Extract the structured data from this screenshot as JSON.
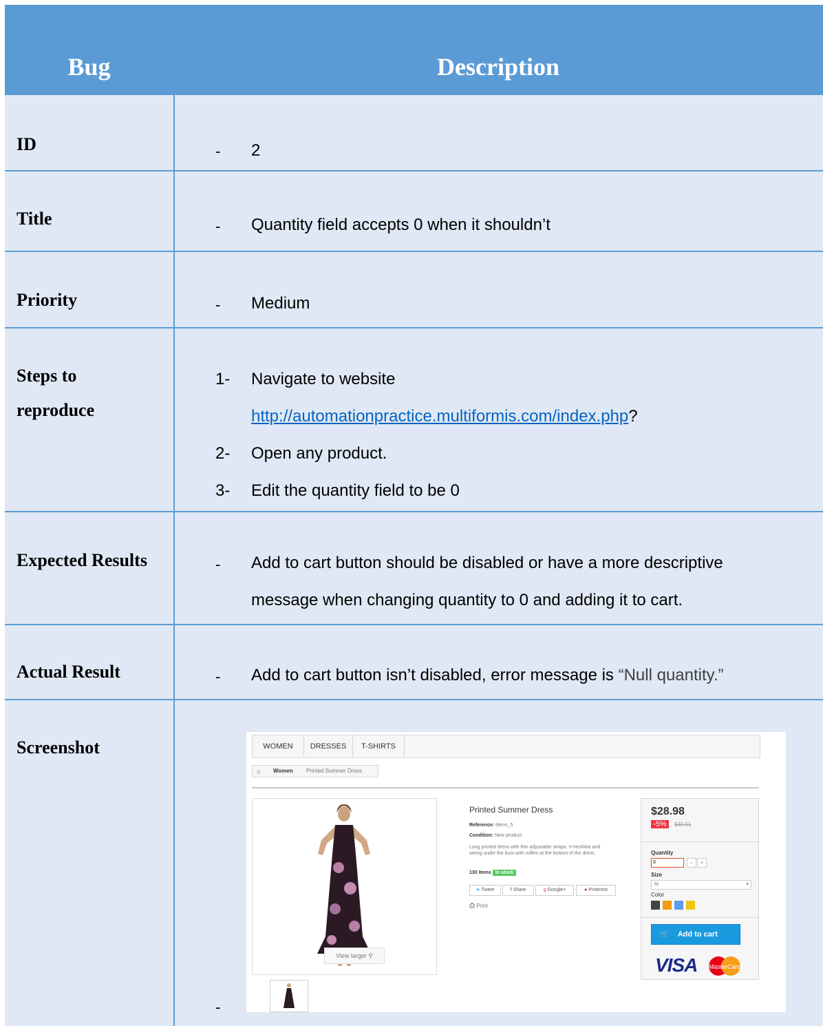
{
  "header": {
    "bug_label": "Bug",
    "description_label": "Description"
  },
  "rows": {
    "id": {
      "label": "ID",
      "dash": "-",
      "value": "2"
    },
    "title": {
      "label": "Title",
      "dash": "-",
      "value": "Quantity field accepts 0 when it shouldn’t"
    },
    "priority": {
      "label": "Priority",
      "dash": "-",
      "value": "Medium"
    },
    "steps": {
      "label_line1": "Steps to",
      "label_line2": "reproduce",
      "step1_num": "1-",
      "step1_text": "Navigate to website",
      "step1_link": "http://automationpractice.multiformis.com/index.php",
      "step1_suffix": "?",
      "step2_num": "2-",
      "step2_text": "Open any product.",
      "step3_num": "3-",
      "step3_text": "Edit the quantity field to be 0"
    },
    "expected": {
      "label": "Expected Results",
      "dash": "-",
      "line1": "Add to cart button should be disabled or have a more descriptive",
      "line2": "message when changing quantity to 0 and adding it to cart."
    },
    "actual": {
      "label": "Actual Result",
      "dash": "-",
      "text": "Add to cart button isn’t disabled, error message is ",
      "quote": "“Null quantity.”"
    },
    "screenshot": {
      "label": "Screenshot",
      "dash": "-"
    }
  },
  "shot": {
    "nav": [
      "WOMEN",
      "DRESSES",
      "T-SHIRTS"
    ],
    "breadcrumb": {
      "home_icon": "home-icon",
      "women": "Women",
      "current": "Printed Summer Dress"
    },
    "view_larger": "View larger",
    "product_name": "Printed Summer Dress",
    "reference_label": "Reference:",
    "reference_value": "demo_5",
    "condition_label": "Condition:",
    "condition_value": "New product",
    "desc_line1": "Long printed dress with thin adjustable straps. V-neckline and",
    "desc_line2": "wiring under the bust with ruffles at the bottom of the dress.",
    "items": "130 Items",
    "in_stock": "In stock",
    "share": [
      "Tweet",
      "Share",
      "Google+",
      "Pinterest"
    ],
    "print": "Print",
    "price": "$28.98",
    "discount": "-5%",
    "old_price": "$30.51",
    "quantity_label": "Quantity",
    "quantity_value": "0",
    "minus": "−",
    "plus": "+",
    "size_label": "Size",
    "size_value": "M",
    "color_label": "Color",
    "colors": [
      "#434343",
      "#f39c11",
      "#5d9cec",
      "#f1c40f"
    ],
    "add_to_cart": "Add to cart",
    "visa": "VISA",
    "mastercard": "MasterCard"
  },
  "colors": {
    "header_bg": "#5b9bd5",
    "row_bg": "#dfe8f4",
    "link": "#0563c1"
  }
}
